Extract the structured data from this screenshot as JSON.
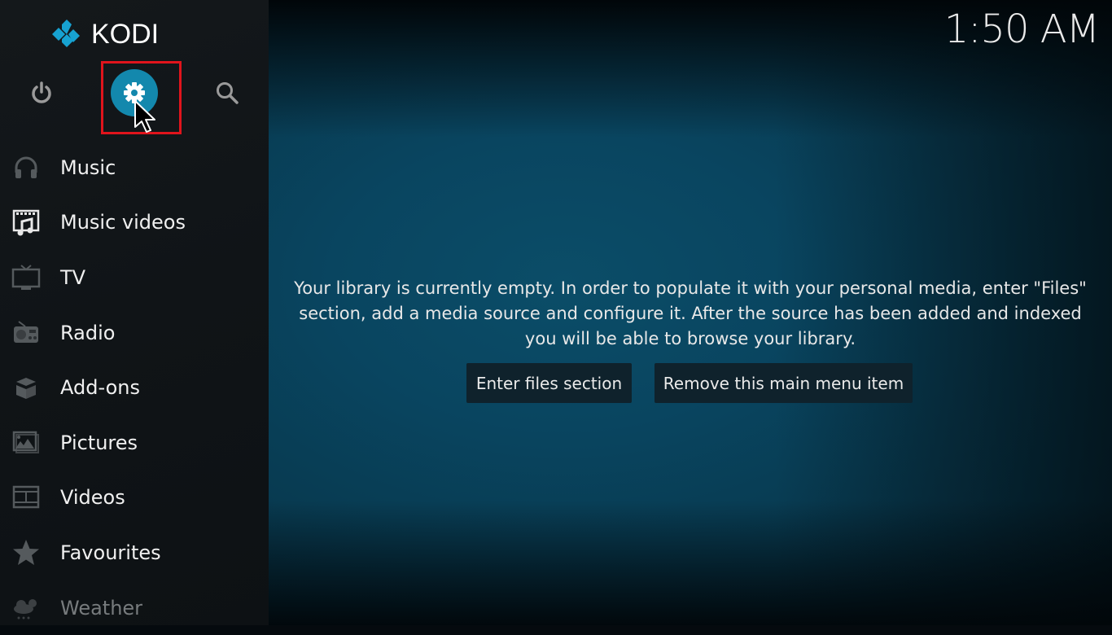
{
  "app": {
    "name": "KODI",
    "accent_color": "#1388ad",
    "highlight_color": "#e0141c"
  },
  "topbar": {
    "buttons": [
      {
        "id": "power",
        "icon": "power-icon"
      },
      {
        "id": "settings",
        "icon": "gear-icon",
        "state": "focused"
      },
      {
        "id": "search",
        "icon": "search-icon"
      }
    ]
  },
  "clock": {
    "time": "1:50 AM"
  },
  "sidebar": {
    "items": [
      {
        "label": "Music",
        "icon": "headphones-icon"
      },
      {
        "label": "Music videos",
        "icon": "music-video-icon"
      },
      {
        "label": "TV",
        "icon": "tv-icon"
      },
      {
        "label": "Radio",
        "icon": "radio-icon"
      },
      {
        "label": "Add-ons",
        "icon": "addons-box-icon"
      },
      {
        "label": "Pictures",
        "icon": "pictures-icon"
      },
      {
        "label": "Videos",
        "icon": "film-icon"
      },
      {
        "label": "Favourites",
        "icon": "star-icon"
      },
      {
        "label": "Weather",
        "icon": "weather-icon"
      }
    ]
  },
  "main": {
    "message": "Your library is currently empty. In order to populate it with your personal media, enter \"Files\" section, add a media source and configure it. After the source has been added and indexed you will be able to browse your library.",
    "buttons": {
      "enter_files": "Enter files section",
      "remove_item": "Remove this main menu item"
    }
  }
}
